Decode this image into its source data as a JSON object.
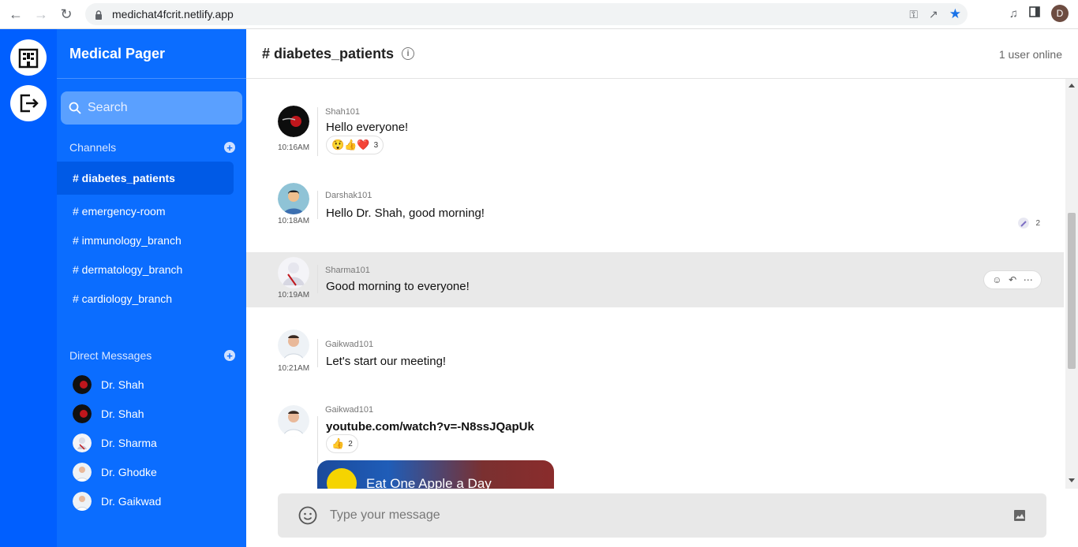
{
  "browser": {
    "url": "medichat4fcrit.netlify.app",
    "profile_initial": "D"
  },
  "app": {
    "brand": "Medical Pager",
    "search": {
      "placeholder": "Search"
    },
    "channels_label": "Channels",
    "channels": [
      {
        "label": "# diabetes_patients",
        "active": true
      },
      {
        "label": "# emergency-room"
      },
      {
        "label": "# immunology_branch"
      },
      {
        "label": "# dermatology_branch"
      },
      {
        "label": "# cardiology_branch"
      }
    ],
    "dms_label": "Direct Messages",
    "dms": [
      {
        "label": "Dr. Shah"
      },
      {
        "label": "Dr. Shah"
      },
      {
        "label": "Dr. Sharma"
      },
      {
        "label": "Dr. Ghodke"
      },
      {
        "label": "Dr. Gaikwad"
      }
    ]
  },
  "channel": {
    "title": "# diabetes_patients",
    "online": "1 user online"
  },
  "messages": [
    {
      "author": "Shah101",
      "time": "10:16AM",
      "text": "Hello everyone!",
      "reactions": "😲👍❤️",
      "reaction_count": "3"
    },
    {
      "author": "Darshak101",
      "time": "10:18AM",
      "text": "Hello Dr. Shah, good morning!",
      "reply_count": "2"
    },
    {
      "author": "Sharma101",
      "time": "10:19AM",
      "text": "Good morning to everyone!"
    },
    {
      "author": "Gaikwad101",
      "time": "10:21AM",
      "text": "Let's start our meeting!"
    },
    {
      "author": "Gaikwad101",
      "text": "youtube.com/watch?v=-N8ssJQapUk",
      "reactions": "👍",
      "reaction_count": "2",
      "video_title": "Eat One Apple a Day"
    }
  ],
  "composer": {
    "placeholder": "Type your message"
  },
  "colors": {
    "rail": "#005fff",
    "sidebar": "#0b6dff",
    "active_channel": "#005ae6"
  }
}
